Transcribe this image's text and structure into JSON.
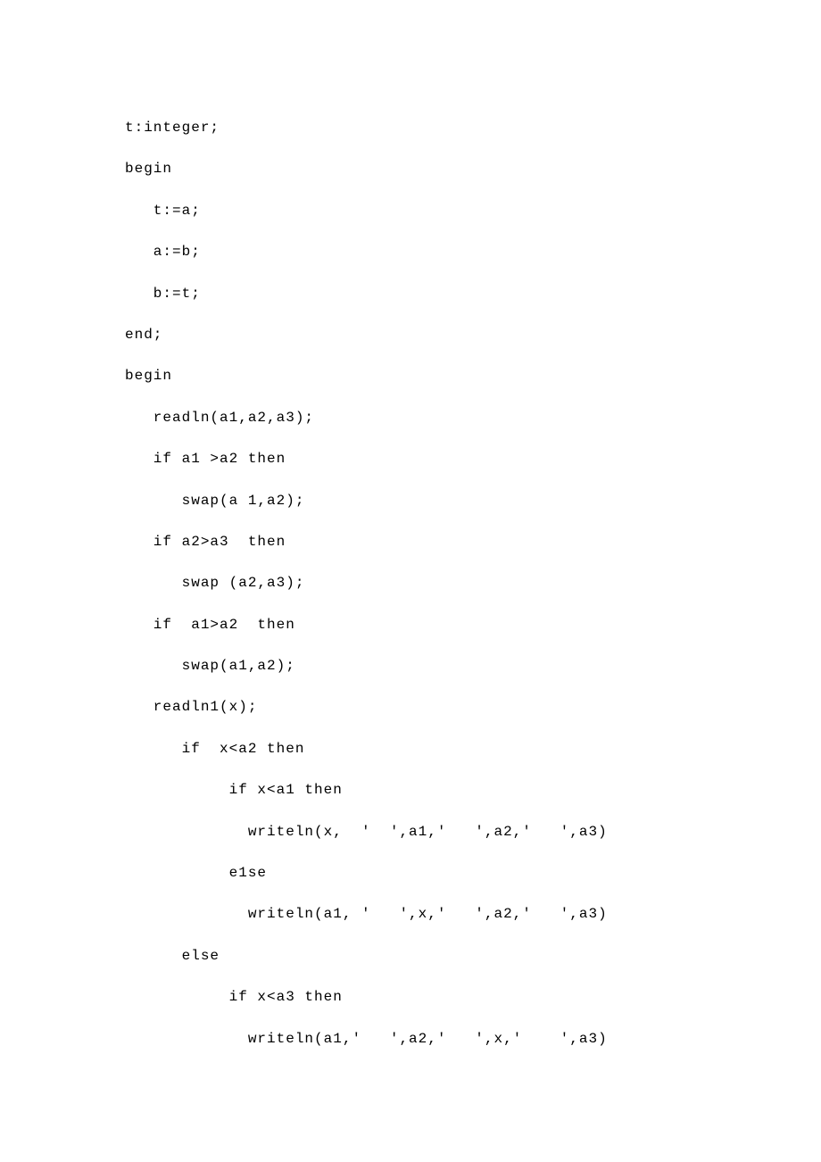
{
  "lines": [
    "t:integer;",
    "begin",
    "   t:=a;",
    "   a:=b;",
    "   b:=t;",
    "end;",
    "begin",
    "   readln(a1,a2,a3);",
    "   if a1 >a2 then",
    "      swap(a 1,a2);",
    "   if a2>a3  then",
    "      swap (a2,a3);",
    "   if  a1>a2  then",
    "      swap(a1,a2);",
    "   readln1(x);",
    "      if  x<a2 then",
    "           if x<a1 then",
    "             writeln(x,  '  ',a1,'   ',a2,'   ',a3)",
    "           e1se",
    "             writeln(a1, '   ',x,'   ',a2,'   ',a3)",
    "      else",
    "           if x<a3 then",
    "             writeln(a1,'   ',a2,'   ',x,'    ',a3)"
  ]
}
